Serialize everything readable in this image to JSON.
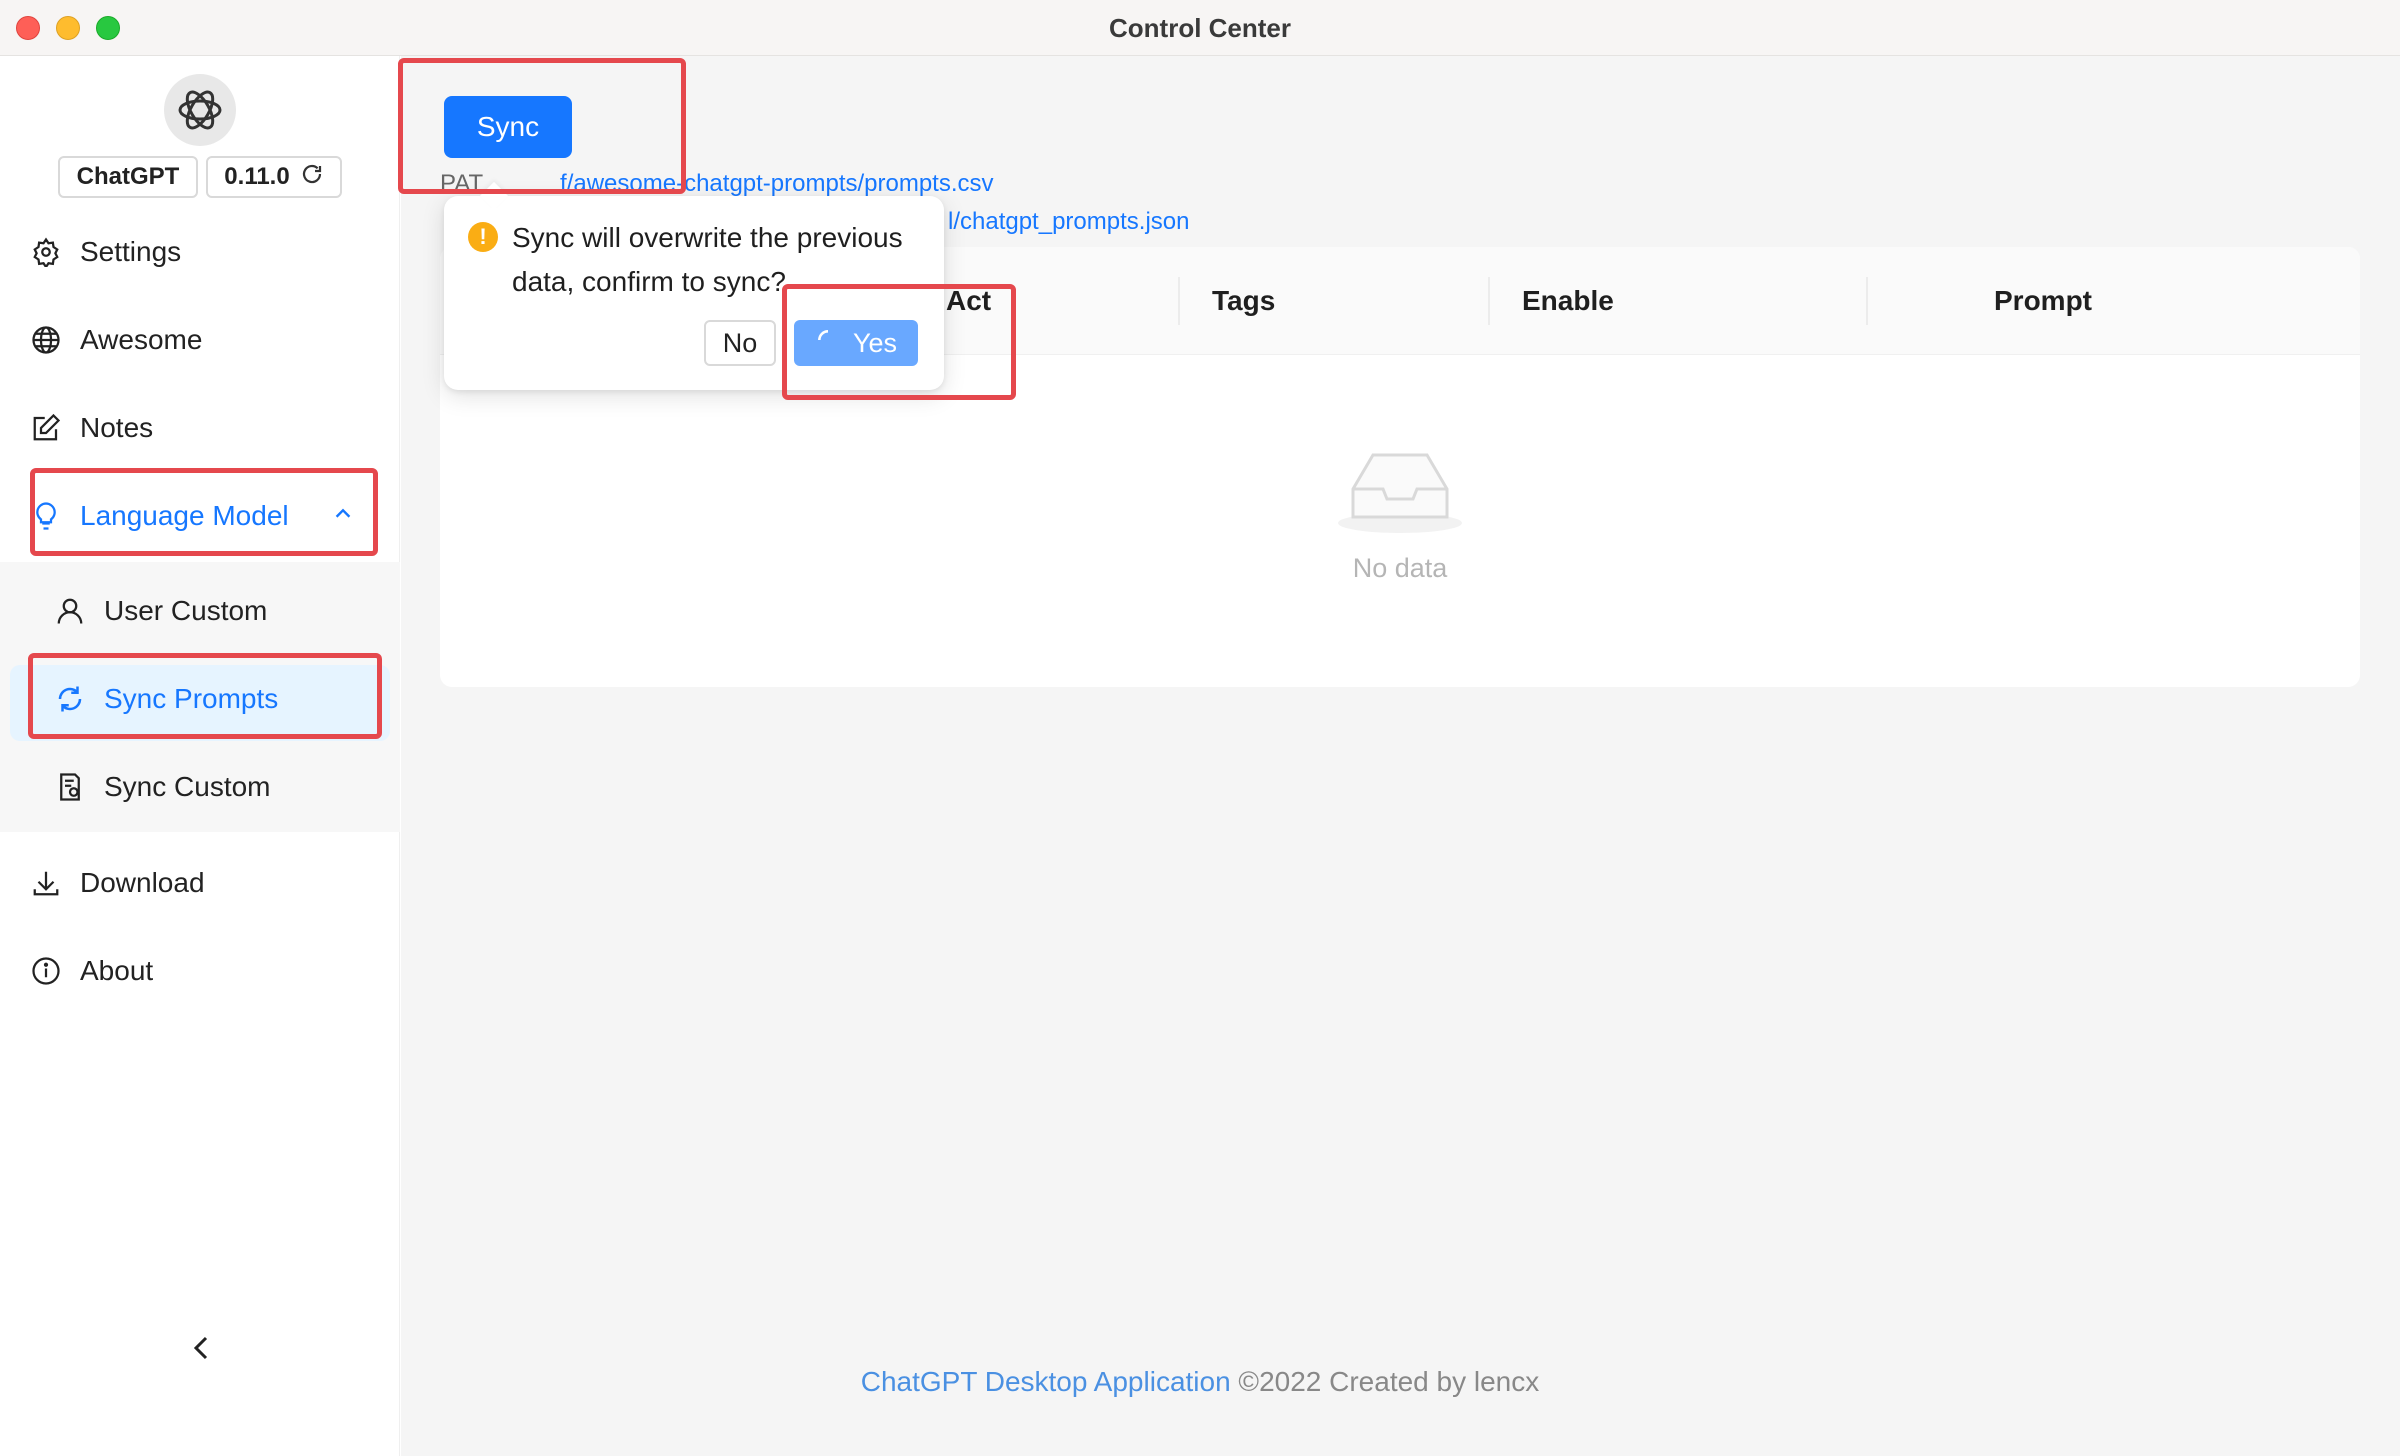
{
  "window": {
    "title": "Control Center"
  },
  "sidebar": {
    "app_name": "ChatGPT",
    "version": "0.11.0",
    "items": [
      {
        "label": "Settings",
        "icon": "gear-icon"
      },
      {
        "label": "Awesome",
        "icon": "globe-icon"
      },
      {
        "label": "Notes",
        "icon": "edit-icon"
      },
      {
        "label": "Language Model",
        "icon": "bulb-icon"
      },
      {
        "label": "User Custom",
        "icon": "user-icon"
      },
      {
        "label": "Sync Prompts",
        "icon": "sync-icon"
      },
      {
        "label": "Sync Custom",
        "icon": "file-sync-icon"
      },
      {
        "label": "Download",
        "icon": "download-icon"
      },
      {
        "label": "About",
        "icon": "info-icon"
      }
    ]
  },
  "main": {
    "sync_label": "Sync",
    "path_prefix": "PAT",
    "path_link": "f/awesome-chatgpt-prompts/prompts.csv",
    "cache_link": "l/chatgpt_prompts.json",
    "table": {
      "columns": [
        "Act",
        "Tags",
        "Enable",
        "Prompt"
      ],
      "empty_text": "No data"
    }
  },
  "popconfirm": {
    "message": "Sync will overwrite the previous data, confirm to sync?",
    "no_label": "No",
    "yes_label": "Yes"
  },
  "footer": {
    "link_text": "ChatGPT Desktop Application",
    "suffix": " ©2022 Created by lencx"
  },
  "colors": {
    "primary": "#1677ff",
    "highlight": "#e5484d",
    "warning": "#faad14"
  }
}
